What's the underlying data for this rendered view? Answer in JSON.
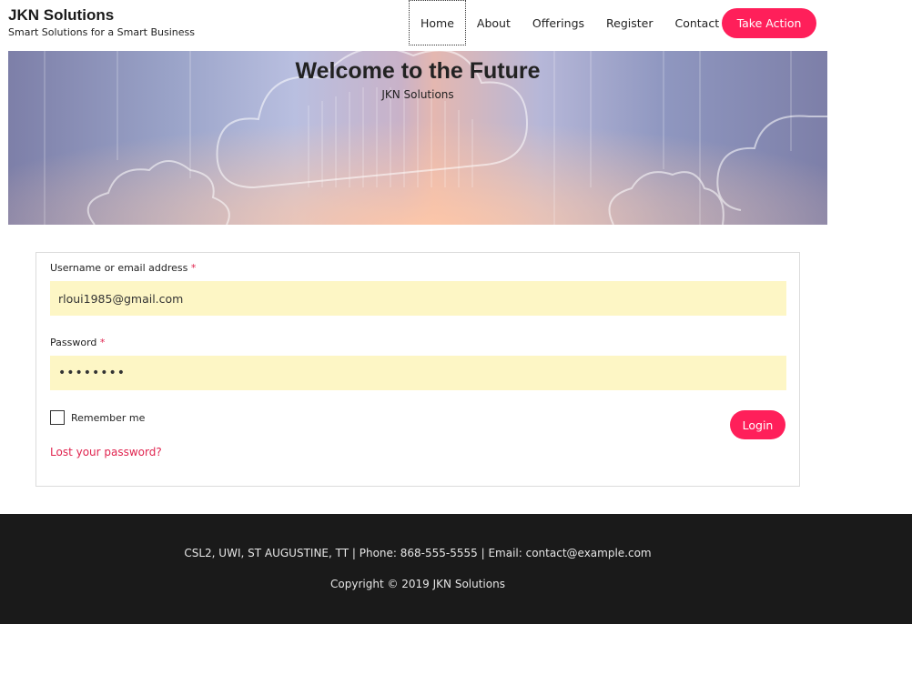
{
  "header": {
    "brand_title": "JKN Solutions",
    "brand_tagline": "Smart Solutions for a Smart Business",
    "nav": [
      {
        "label": "Home",
        "active": true
      },
      {
        "label": "About"
      },
      {
        "label": "Offerings"
      },
      {
        "label": "Register"
      },
      {
        "label": "Contact"
      }
    ],
    "cta_label": "Take Action"
  },
  "hero": {
    "title": "Welcome to the Future",
    "subtitle": "JKN Solutions"
  },
  "login_form": {
    "username_label": "Username or email address",
    "username_value": "rloui1985@gmail.com",
    "password_label": "Password",
    "password_value": "••••••••",
    "required_marker": "*",
    "remember_label": "Remember me",
    "remember_checked": false,
    "login_label": "Login",
    "lost_password_label": "Lost your password?"
  },
  "footer": {
    "contact_line": "CSL2, UWI, ST AUGUSTINE, TT | Phone: 868-555-5555 | Email: contact@example.com",
    "copyright": "Copyright © 2019 JKN Solutions"
  },
  "colors": {
    "accent": "#ff1f5a",
    "input_background": "#fdf6c5",
    "footer_background": "#1a1a1a"
  }
}
